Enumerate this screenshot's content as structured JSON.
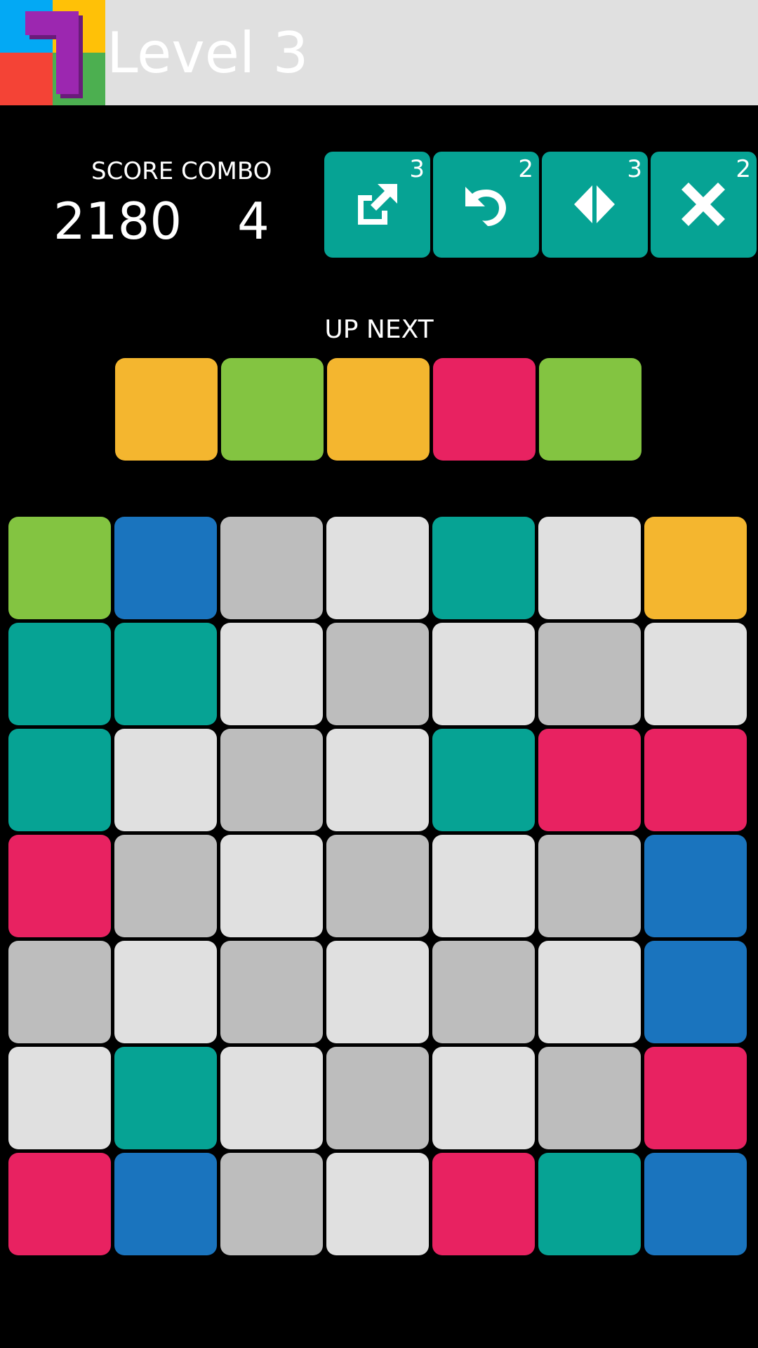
{
  "header": {
    "title": "Level 3",
    "background": "#e0e0e0"
  },
  "stats": {
    "score_label": "SCORE",
    "combo_label": "COMBO",
    "score": "2180",
    "combo": "4"
  },
  "powerups": [
    {
      "name": "powerup-launch",
      "icon": "external-launch-icon",
      "count": "3"
    },
    {
      "name": "powerup-undo",
      "icon": "undo-icon",
      "count": "2"
    },
    {
      "name": "powerup-swap",
      "icon": "swap-arrows-icon",
      "count": "3"
    },
    {
      "name": "powerup-remove",
      "icon": "close-icon",
      "count": "2"
    }
  ],
  "up_next": {
    "label": "UP NEXT",
    "tiles": [
      "yellow",
      "green",
      "yellow",
      "pink",
      "green"
    ]
  },
  "colors": {
    "yellow": "#f4b62f",
    "green": "#83c441",
    "pink": "#e82261",
    "teal": "#06a394",
    "blue": "#1a74be",
    "grey": "#bdbdbd",
    "light": "#e0e0e0",
    "powerup_bg": "#06a394"
  },
  "board": [
    [
      "green",
      "blue",
      "grey",
      "light",
      "teal",
      "light",
      "yellow"
    ],
    [
      "teal",
      "teal",
      "light",
      "grey",
      "light",
      "grey",
      "light"
    ],
    [
      "teal",
      "light",
      "grey",
      "light",
      "teal",
      "pink",
      "pink"
    ],
    [
      "pink",
      "grey",
      "light",
      "grey",
      "light",
      "grey",
      "blue"
    ],
    [
      "grey",
      "light",
      "grey",
      "light",
      "grey",
      "light",
      "blue"
    ],
    [
      "light",
      "teal",
      "light",
      "grey",
      "light",
      "grey",
      "pink"
    ],
    [
      "pink",
      "blue",
      "grey",
      "light",
      "pink",
      "teal",
      "blue"
    ]
  ]
}
